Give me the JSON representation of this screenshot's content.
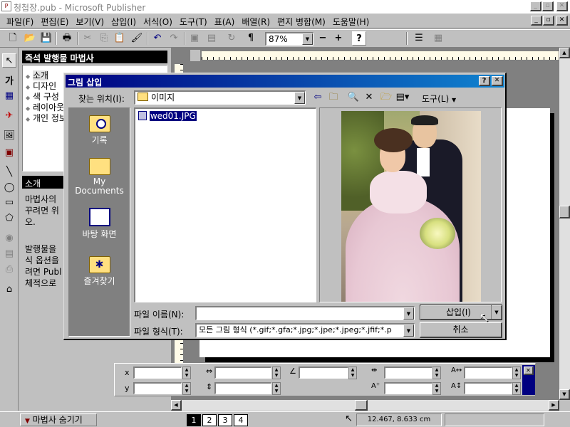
{
  "app": {
    "title": "청첩장.pub - Microsoft Publisher",
    "window_controls": [
      "_",
      "🗗",
      "✕"
    ]
  },
  "menu": [
    "파일(F)",
    "편집(E)",
    "보기(V)",
    "삽입(I)",
    "서식(O)",
    "도구(T)",
    "표(A)",
    "배열(R)",
    "편지 병합(M)",
    "도움말(H)"
  ],
  "toolbar": {
    "zoom": "87%",
    "zoom_minus": "−",
    "zoom_plus": "+"
  },
  "wizard": {
    "title": "즉석 발행물 마법사",
    "items": [
      "소개",
      "디자인",
      "색 구성",
      "레이아웃",
      "개인 정보"
    ],
    "intro_heading": "소개",
    "intro_text_1": [
      "마법사의",
      "꾸려면 위",
      "오."
    ],
    "intro_text_2": [
      "발행물을",
      "식 옵션을",
      "려면 Publ",
      "체적으로"
    ]
  },
  "dialog": {
    "title": "그림 삽입",
    "help": "?",
    "close": "✕",
    "look_in_label": "찾는 위치(I):",
    "look_in_value": "이미지",
    "tools_label": "도구(L)",
    "places": [
      "기록",
      "My Documents",
      "바탕 화면",
      "즐겨찾기"
    ],
    "files": [
      "wed01.JPG"
    ],
    "filename_label": "파일 이름(N):",
    "filename_value": "",
    "filetype_label": "파일 형식(T):",
    "filetype_value": "모든 그림 형식 (*.gif;*.gfa;*.jpg;*.jpe;*.jpeg;*.jfif;*.p",
    "insert_button": "삽입(I)",
    "cancel_button": "취소"
  },
  "measure": {
    "x_label": "x",
    "y_label": "y"
  },
  "status": {
    "hide_wizard": "마법사 숨기기",
    "pages": [
      "1",
      "2",
      "3",
      "4"
    ],
    "current_page": "1",
    "coords": "12.467, 8.633 cm"
  },
  "colors": {
    "title_active": "#000080",
    "title_active_end": "#1084d0",
    "workspace": "#808080",
    "dialog_face": "#c0c0c0",
    "places_bar": "#808080"
  }
}
